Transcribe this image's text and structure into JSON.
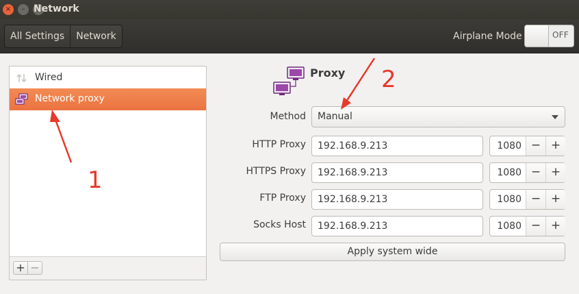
{
  "window": {
    "title": "Network",
    "controls": {
      "close_glyph": "×",
      "minimize_glyph": "–",
      "maximize_glyph": "□"
    }
  },
  "header": {
    "breadcrumbs": [
      "All Settings",
      "Network"
    ],
    "airplane_mode": {
      "label": "Airplane Mode",
      "state": "OFF"
    }
  },
  "sidebar": {
    "items": [
      {
        "label": "Wired",
        "icon": "wired-icon",
        "selected": false
      },
      {
        "label": "Network proxy",
        "icon": "network-proxy-icon",
        "selected": true
      }
    ],
    "add_glyph": "+",
    "remove_glyph": "−"
  },
  "proxy": {
    "title": "Proxy",
    "icon": "network-proxy-icon",
    "method": {
      "label": "Method",
      "value": "Manual"
    },
    "rows": [
      {
        "label": "HTTP Proxy",
        "host": "192.168.9.213",
        "port": "1080"
      },
      {
        "label": "HTTPS Proxy",
        "host": "192.168.9.213",
        "port": "1080"
      },
      {
        "label": "FTP Proxy",
        "host": "192.168.9.213",
        "port": "1080"
      },
      {
        "label": "Socks Host",
        "host": "192.168.9.213",
        "port": "1080"
      }
    ],
    "spin_minus": "−",
    "spin_plus": "+",
    "apply_label": "Apply system wide"
  },
  "annotations": {
    "marker_1": "1",
    "marker_2": "2",
    "color": "#e8382a"
  },
  "colors": {
    "accent": "#ef7b45",
    "titlebar": "#3c3b37",
    "panel_bg": "#f2f1f0"
  }
}
